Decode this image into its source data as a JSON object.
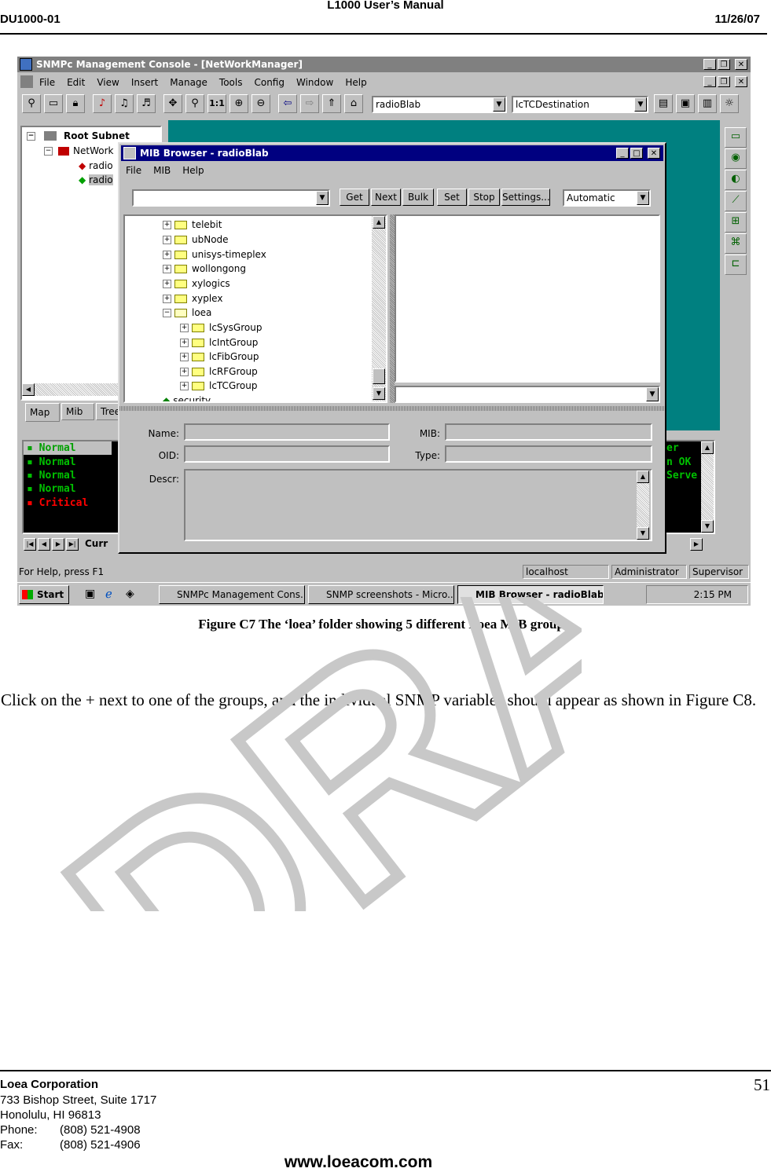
{
  "header": {
    "title": "L1000 User’s Manual",
    "doc_id": "DU1000-01",
    "date": "11/26/07"
  },
  "app": {
    "title": "SNMPc Management Console - [NetWorkManager]",
    "menu": [
      "File",
      "Edit",
      "View",
      "Insert",
      "Manage",
      "Tools",
      "Config",
      "Window",
      "Help"
    ],
    "combo1": "radioBlab",
    "combo2": "lcTCDestination",
    "tree": {
      "root": "Root Subnet",
      "child": "NetWork",
      "items": [
        "radio",
        "radio"
      ]
    },
    "left_tabs": [
      "Map",
      "Mib",
      "Tree"
    ],
    "events": [
      {
        "text": "Normal",
        "color": "#00c000"
      },
      {
        "text": "Normal",
        "color": "#00c000"
      },
      {
        "text": "Normal",
        "color": "#00c000"
      },
      {
        "text": "Normal",
        "color": "#00c000"
      },
      {
        "text": "Critical",
        "color": "#ff0000"
      }
    ],
    "events_tab": "Curr",
    "events_right": [
      "er",
      "n OK",
      "Serve"
    ],
    "status": {
      "help": "For Help, press F1",
      "host": "localhost",
      "user": "Administrator",
      "role": "Supervisor"
    },
    "taskbar": {
      "start": "Start",
      "tasks": [
        "SNMPc Management Cons...",
        "SNMP screenshots - Micro...",
        "MIB Browser - radioBlab"
      ],
      "clock": "2:15 PM"
    }
  },
  "mib": {
    "title": "MIB Browser - radioBlab",
    "menu": [
      "File",
      "MIB",
      "Help"
    ],
    "buttons": [
      "Get",
      "Next",
      "Bulk",
      "Set",
      "Stop",
      "Settings..."
    ],
    "mode": "Automatic",
    "tree": [
      "telebit",
      "ubNode",
      "unisys-timeplex",
      "wollongong",
      "xylogics",
      "xyplex",
      "loea"
    ],
    "groups": [
      "lcSysGroup",
      "lcIntGroup",
      "lcFibGroup",
      "lcRFGroup",
      "lcTCGroup"
    ],
    "last": "security",
    "labels": {
      "name": "Name:",
      "oid": "OID:",
      "descr": "Descr:",
      "mib": "MIB:",
      "type": "Type:"
    }
  },
  "caption": "Figure C7  The ‘loea’ folder showing 5 different Loea MIB groups.",
  "paragraph": "Click on the + next to one of the groups, and the individual SNMP variables should appear as shown in Figure C8.",
  "watermark": "DRAFT",
  "footer": {
    "company": "Loea Corporation",
    "address1": "733 Bishop Street, Suite 1717",
    "address2": "Honolulu, HI  96813",
    "phone_label": "Phone:",
    "phone": "(808) 521-4908",
    "fax_label": "Fax:",
    "fax": "(808) 521-4906",
    "page": "51",
    "website": "www.loeacom.com"
  }
}
